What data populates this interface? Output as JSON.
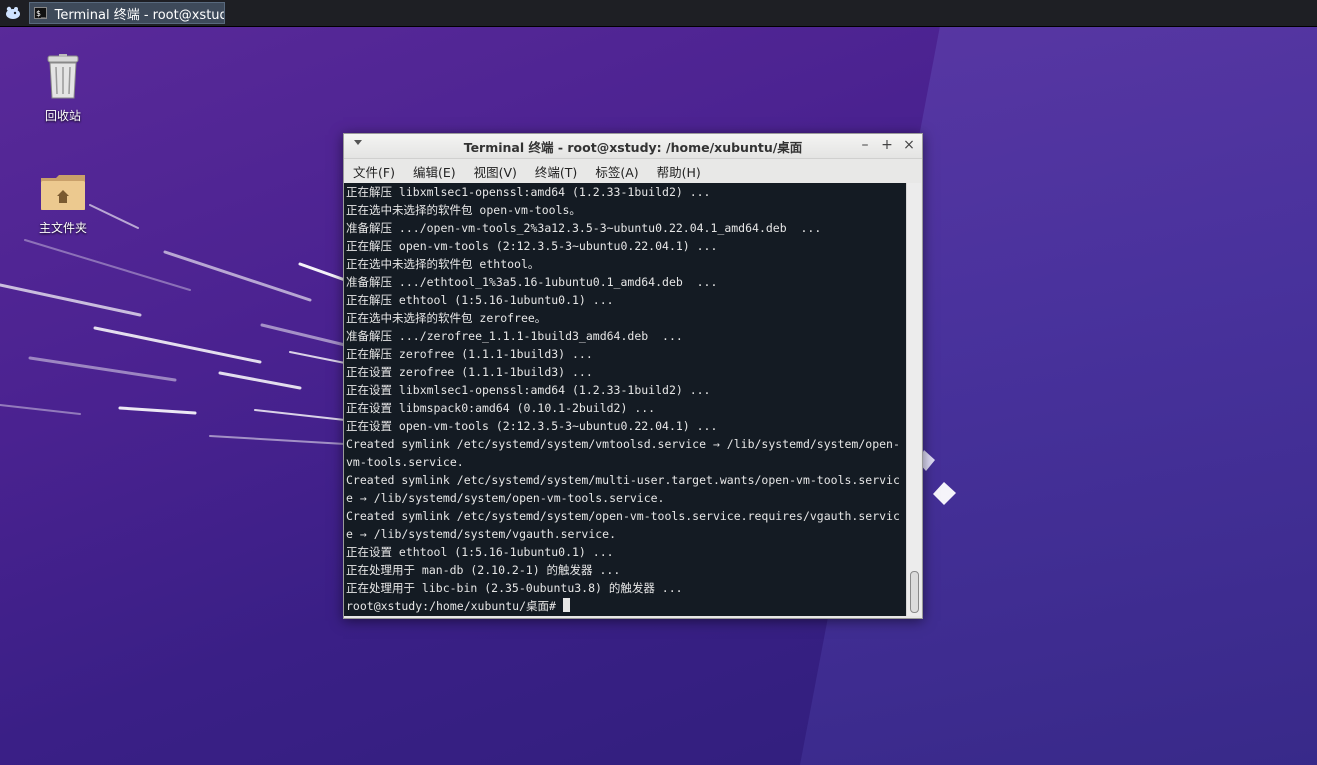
{
  "taskbar": {
    "app_menu_icon": "xfce-mouse-icon",
    "task_title": "Terminal 终端 - root@xstudy..."
  },
  "desktop": {
    "icons": [
      {
        "label": "回收站",
        "icon": "trash-icon"
      },
      {
        "label": "主文件夹",
        "icon": "home-folder-icon"
      }
    ]
  },
  "terminal": {
    "title": "Terminal 终端 - root@xstudy: /home/xubuntu/桌面",
    "menu": [
      "文件(F)",
      "编辑(E)",
      "视图(V)",
      "终端(T)",
      "标签(A)",
      "帮助(H)"
    ],
    "lines": [
      "正在解压 libxmlsec1-openssl:amd64 (1.2.33-1build2) ...",
      "正在选中未选择的软件包 open-vm-tools。",
      "准备解压 .../open-vm-tools_2%3a12.3.5-3~ubuntu0.22.04.1_amd64.deb  ...",
      "正在解压 open-vm-tools (2:12.3.5-3~ubuntu0.22.04.1) ...",
      "正在选中未选择的软件包 ethtool。",
      "准备解压 .../ethtool_1%3a5.16-1ubuntu0.1_amd64.deb  ...",
      "正在解压 ethtool (1:5.16-1ubuntu0.1) ...",
      "正在选中未选择的软件包 zerofree。",
      "准备解压 .../zerofree_1.1.1-1build3_amd64.deb  ...",
      "正在解压 zerofree (1.1.1-1build3) ...",
      "正在设置 zerofree (1.1.1-1build3) ...",
      "正在设置 libxmlsec1-openssl:amd64 (1.2.33-1build2) ...",
      "正在设置 libmspack0:amd64 (0.10.1-2build2) ...",
      "正在设置 open-vm-tools (2:12.3.5-3~ubuntu0.22.04.1) ...",
      "Created symlink /etc/systemd/system/vmtoolsd.service → /lib/systemd/system/open-",
      "vm-tools.service.",
      "Created symlink /etc/systemd/system/multi-user.target.wants/open-vm-tools.servic",
      "e → /lib/systemd/system/open-vm-tools.service.",
      "Created symlink /etc/systemd/system/open-vm-tools.service.requires/vgauth.servic",
      "e → /lib/systemd/system/vgauth.service.",
      "正在设置 ethtool (1:5.16-1ubuntu0.1) ...",
      "正在处理用于 man-db (2.10.2-1) 的触发器 ...",
      "正在处理用于 libc-bin (2.35-0ubuntu3.8) 的触发器 ..."
    ],
    "prompt": "root@xstudy:/home/xubuntu/桌面# "
  }
}
